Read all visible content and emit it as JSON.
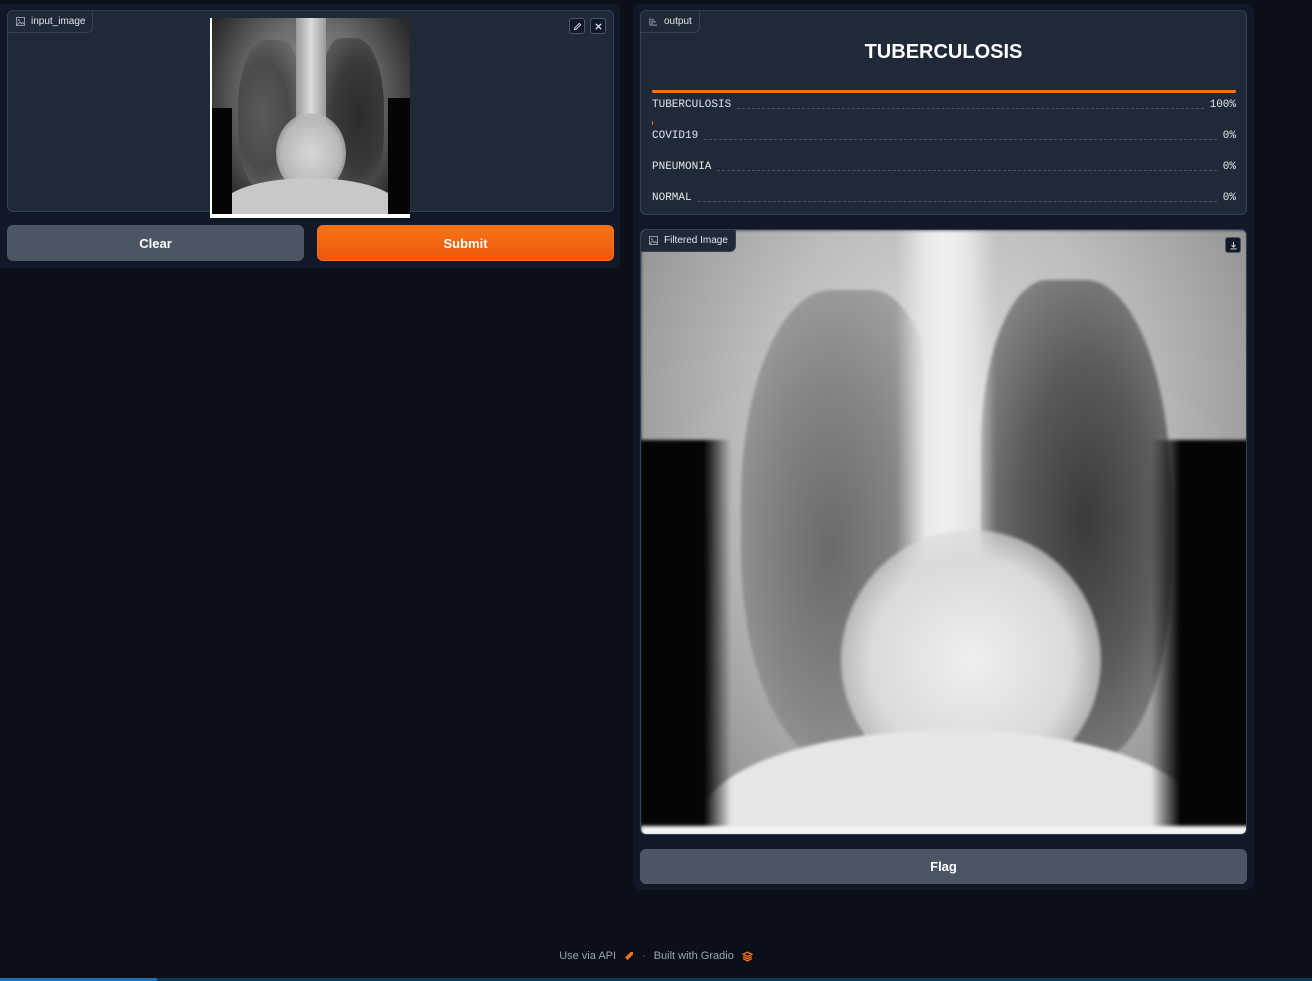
{
  "input_panel": {
    "label": "input_image",
    "icons": [
      "image-icon",
      "pencil-icon",
      "close-icon"
    ]
  },
  "buttons": {
    "clear": "Clear",
    "submit": "Submit",
    "flag": "Flag"
  },
  "output_panel": {
    "label": "output",
    "predicted": "TUBERCULOSIS",
    "confidences": [
      {
        "label": "TUBERCULOSIS",
        "value": "100%",
        "fraction": 1.0
      },
      {
        "label": "COVID19",
        "value": "0%",
        "fraction": 0.0
      },
      {
        "label": "PNEUMONIA",
        "value": "0%",
        "fraction": 0.0
      },
      {
        "label": "NORMAL",
        "value": "0%",
        "fraction": 0.0
      }
    ]
  },
  "filtered_panel": {
    "label": "Filtered Image",
    "icons": [
      "image-icon",
      "download-icon"
    ]
  },
  "footer": {
    "api": "Use via API",
    "separator": "·",
    "built": "Built with Gradio"
  },
  "colors": {
    "accent": "#f97316",
    "background": "#0b0f19",
    "panel": "#1f2937"
  }
}
